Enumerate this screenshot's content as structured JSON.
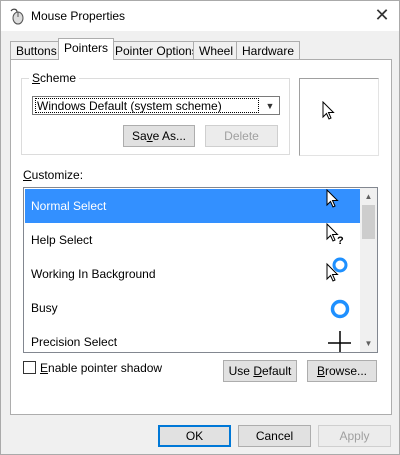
{
  "window": {
    "title": "Mouse Properties",
    "title_icon": "mouse-icon",
    "close_glyph": "✕"
  },
  "tabs": [
    {
      "label": "Buttons",
      "active": false
    },
    {
      "label": "Pointers",
      "active": true
    },
    {
      "label": "Pointer Options",
      "active": false
    },
    {
      "label": "Wheel",
      "active": false
    },
    {
      "label": "Hardware",
      "active": false
    }
  ],
  "scheme": {
    "group_label_accel": "S",
    "group_label_rest": "cheme",
    "selected": "Windows Default (system scheme)",
    "save_as_accel": "v",
    "save_as_pre": "Sa",
    "save_as_post": "e As...",
    "delete_label": "Delete"
  },
  "customize": {
    "label_accel": "C",
    "label_rest": "ustomize:",
    "items": [
      {
        "label": "Normal Select",
        "icon": "arrow-pointer-icon",
        "selected": true
      },
      {
        "label": "Help Select",
        "icon": "help-pointer-icon",
        "selected": false
      },
      {
        "label": "Working In Background",
        "icon": "working-pointer-icon",
        "selected": false
      },
      {
        "label": "Busy",
        "icon": "busy-pointer-icon",
        "selected": false
      },
      {
        "label": "Precision Select",
        "icon": "crosshair-pointer-icon",
        "selected": false
      }
    ]
  },
  "options": {
    "shadow_accel": "E",
    "shadow_rest": "nable pointer shadow",
    "shadow_checked": false,
    "use_default_pre": "Use ",
    "use_default_accel": "D",
    "use_default_post": "efault",
    "browse_accel": "B",
    "browse_rest": "rowse..."
  },
  "footer": {
    "ok": "OK",
    "cancel": "Cancel",
    "apply": "Apply"
  },
  "colors": {
    "selection": "#3390ff",
    "focus_border": "#0078d7",
    "busy_ring": "#1e90ff"
  }
}
